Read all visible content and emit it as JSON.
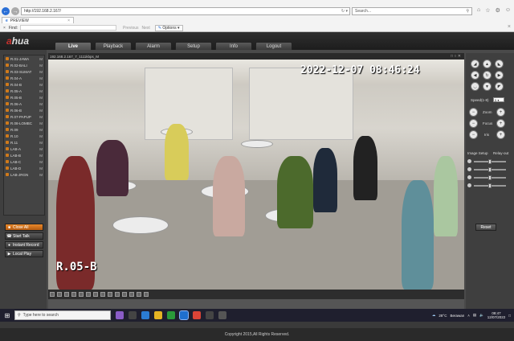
{
  "browser": {
    "url": "http://192.168.2.167/",
    "search_placeholder": "Search...",
    "tab_title": "PREVIEW",
    "find_label": "Find:",
    "find_previous": "Previous",
    "find_next": "Next",
    "find_options": "Options"
  },
  "app": {
    "logo_prefix": "a",
    "logo_text": "hua",
    "menus": [
      "Live",
      "Playback",
      "Alarm",
      "Setup",
      "Info",
      "Logout"
    ],
    "active_menu": "Live",
    "footer": "Copyright 2015,All Rights Reserved."
  },
  "channels": [
    {
      "name": "R.01-JAWA",
      "m": "M"
    },
    {
      "name": "R.02-BALI",
      "m": "M"
    },
    {
      "name": "R.03-SUMAT",
      "m": "M"
    },
    {
      "name": "R.04-A",
      "m": "M"
    },
    {
      "name": "R.04-B",
      "m": "M"
    },
    {
      "name": "R.05-A",
      "m": "M"
    },
    {
      "name": "R.05-B",
      "m": "M"
    },
    {
      "name": "R.06-A",
      "m": "M"
    },
    {
      "name": "R.06-B",
      "m": "M"
    },
    {
      "name": "R.07-PAPUP",
      "m": "M"
    },
    {
      "name": "R.08-LOMBC",
      "m": "M"
    },
    {
      "name": "R.09",
      "m": "M"
    },
    {
      "name": "R.10",
      "m": "M"
    },
    {
      "name": "R.11",
      "m": "M"
    },
    {
      "name": "LAB-A",
      "m": "M"
    },
    {
      "name": "LAB-B",
      "m": "M"
    },
    {
      "name": "LAB-C",
      "m": "M"
    },
    {
      "name": "LAB-D",
      "m": "M"
    },
    {
      "name": "LAB-JRGN",
      "m": "M"
    }
  ],
  "left_buttons": {
    "close_all": "Close All",
    "start_talk": "Start Talk",
    "instant_record": "Instant Record",
    "local_play": "Local Play"
  },
  "video": {
    "title": "192.168.2.167_7_1111kbps_M",
    "timestamp": "2022-12-07  08:46:24",
    "camera_label": "R.05-B"
  },
  "ptz": {
    "speed_label": "Speed(1-8)",
    "speed_value": "5",
    "zoom_label": "Zoom",
    "focus_label": "Focus",
    "iris_label": "Iris",
    "image_setup_label": "Image Setup",
    "relay_out_label": "Relay-out",
    "reset_label": "Reset",
    "sliders": [
      0.5,
      0.5,
      0.5,
      0.5
    ]
  },
  "taskbar": {
    "search_placeholder": "Type here to search",
    "weather_temp": "28°C",
    "weather_desc": "Berawan",
    "time": "08:47",
    "date": "12/07/2022"
  }
}
